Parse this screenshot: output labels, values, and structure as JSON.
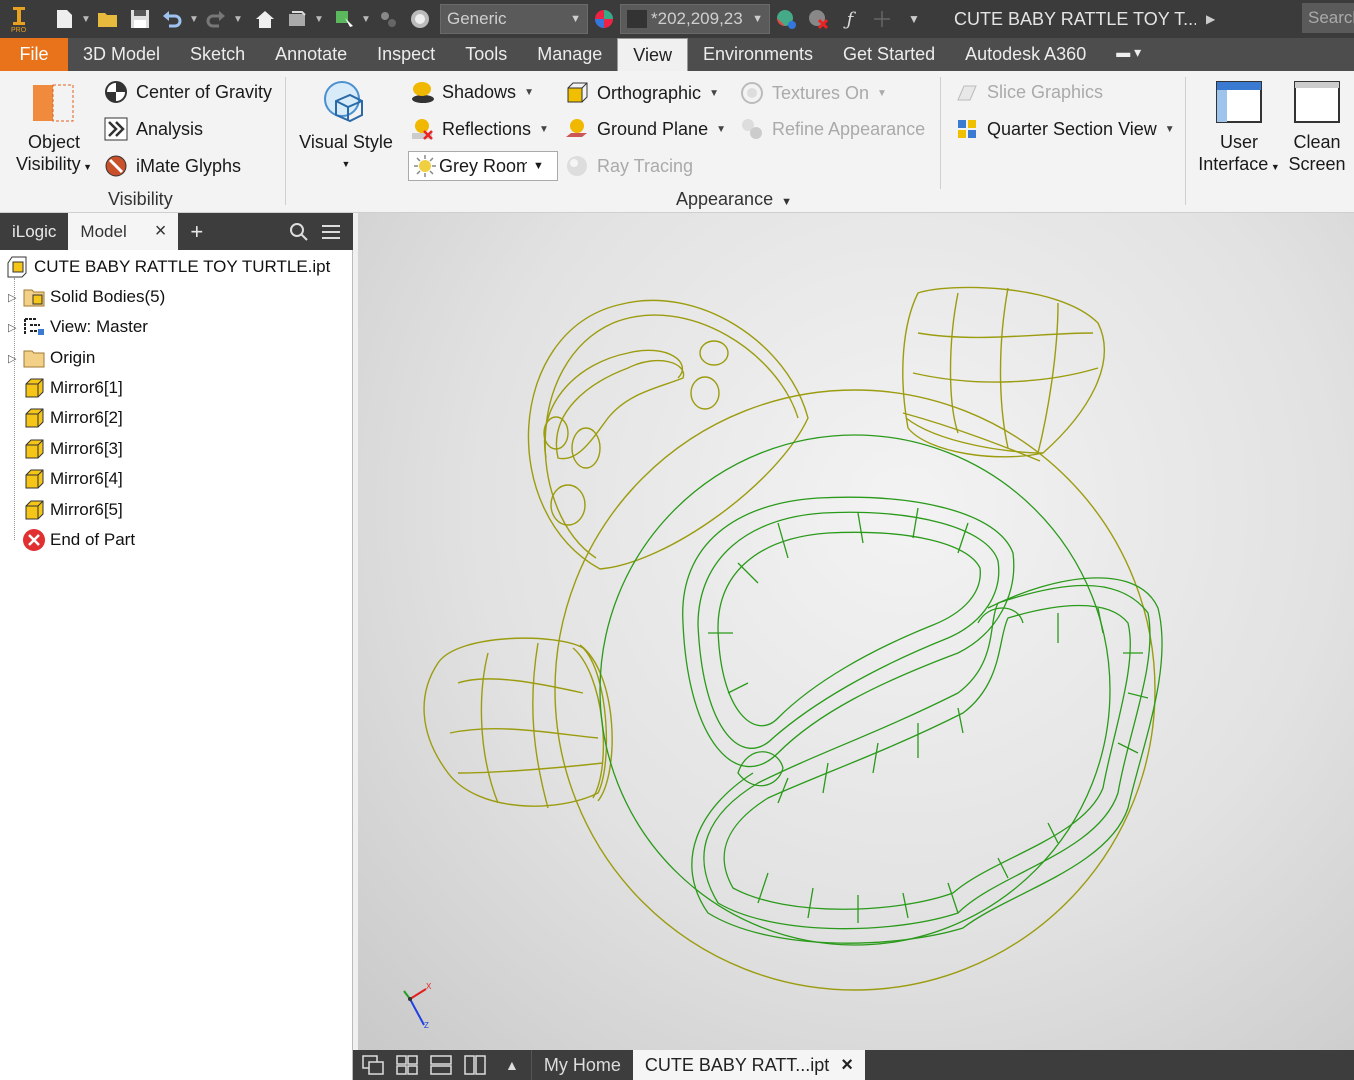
{
  "quick_access": {
    "material": "Generic",
    "appearance": "*202,209,23",
    "document_title": "CUTE BABY RATTLE TOY T...",
    "search_placeholder": "Search"
  },
  "ribbon_tabs": [
    "File",
    "3D Model",
    "Sketch",
    "Annotate",
    "Inspect",
    "Tools",
    "Manage",
    "View",
    "Environments",
    "Get Started",
    "Autodesk A360"
  ],
  "active_tab": "View",
  "visibility_panel": {
    "object_visibility": [
      "Object",
      "Visibility"
    ],
    "center_of_gravity": "Center of Gravity",
    "analysis": "Analysis",
    "imate_glyphs": "iMate Glyphs",
    "label": "Visibility"
  },
  "appearance_panel": {
    "visual_style": "Visual Style",
    "shadows": "Shadows",
    "reflections": "Reflections",
    "lighting_style": "Grey Room",
    "orthographic": "Orthographic",
    "ground_plane": "Ground Plane",
    "ray_tracing": "Ray Tracing",
    "textures_on": "Textures On",
    "refine_appearance": "Refine Appearance",
    "slice_graphics": "Slice Graphics",
    "quarter_section_view": "Quarter Section View",
    "label": "Appearance"
  },
  "windows_panel": {
    "user_interface": [
      "User",
      "Interface"
    ],
    "clean_screen": [
      "Clean",
      "Screen"
    ]
  },
  "browser": {
    "tabs": [
      "iLogic",
      "Model"
    ],
    "root": "CUTE BABY RATTLE TOY TURTLE.ipt",
    "nodes": [
      "Solid Bodies(5)",
      "View: Master",
      "Origin",
      "Mirror6[1]",
      "Mirror6[2]",
      "Mirror6[3]",
      "Mirror6[4]",
      "Mirror6[5]",
      "End of Part"
    ]
  },
  "document_tabs": {
    "home": "My Home",
    "current": "CUTE BABY RATT...ipt"
  },
  "colors": {
    "file_tab": "#e8731a",
    "wire_body": "#2a9a1a",
    "wire_limbs": "#9c9c10"
  }
}
